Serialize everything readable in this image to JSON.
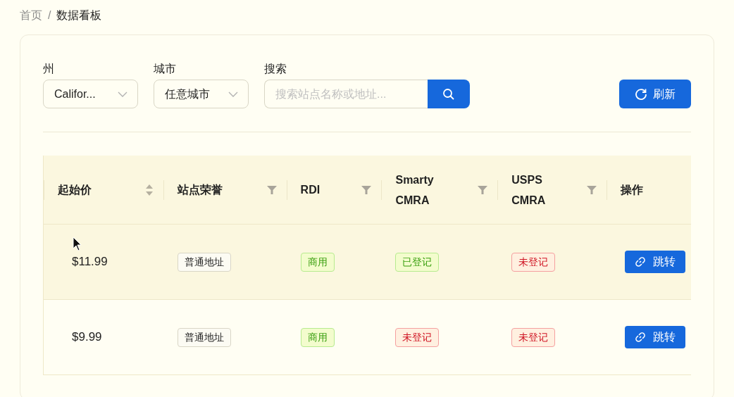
{
  "breadcrumb": [
    {
      "label": "首页",
      "current": false
    },
    {
      "label": "/",
      "current": false
    },
    {
      "label": "数据看板",
      "current": true
    }
  ],
  "filters": [
    {
      "kind": "select",
      "label": "州",
      "value": "Califor..."
    },
    {
      "kind": "select",
      "label": "城市",
      "value": "任意城市"
    },
    {
      "kind": "search",
      "label": "搜索",
      "placeholder": "搜索站点名称或地址..."
    }
  ],
  "refresh_button": {
    "label": "刷新"
  },
  "table": {
    "columns": [
      {
        "label": "起始价",
        "kind": "sort"
      },
      {
        "label": "站点荣誉",
        "kind": "filter"
      },
      {
        "label": "RDI",
        "kind": "filter"
      },
      {
        "label": "Smarty CMRA",
        "kind": "filter"
      },
      {
        "label": "USPS CMRA",
        "kind": "filter"
      },
      {
        "label": "操作",
        "kind": "plain"
      }
    ],
    "rows": [
      {
        "highlighted": true,
        "price": "$11.99",
        "tags": [
          {
            "label": "普通地址",
            "color": "#262626"
          },
          {
            "label": "商用",
            "color": "#389e0d"
          },
          {
            "label": "已登记",
            "color": "#389e0d"
          },
          {
            "label": "未登记",
            "color": "#cf1322"
          }
        ],
        "action": "跳转"
      },
      {
        "highlighted": false,
        "price": "$9.99",
        "tags": [
          {
            "label": "普通地址",
            "color": "#262626"
          },
          {
            "label": "商用",
            "color": "#389e0d"
          },
          {
            "label": "未登记",
            "color": "#cf1322"
          },
          {
            "label": "未登记",
            "color": "#cf1322"
          }
        ],
        "action": "跳转"
      }
    ]
  }
}
